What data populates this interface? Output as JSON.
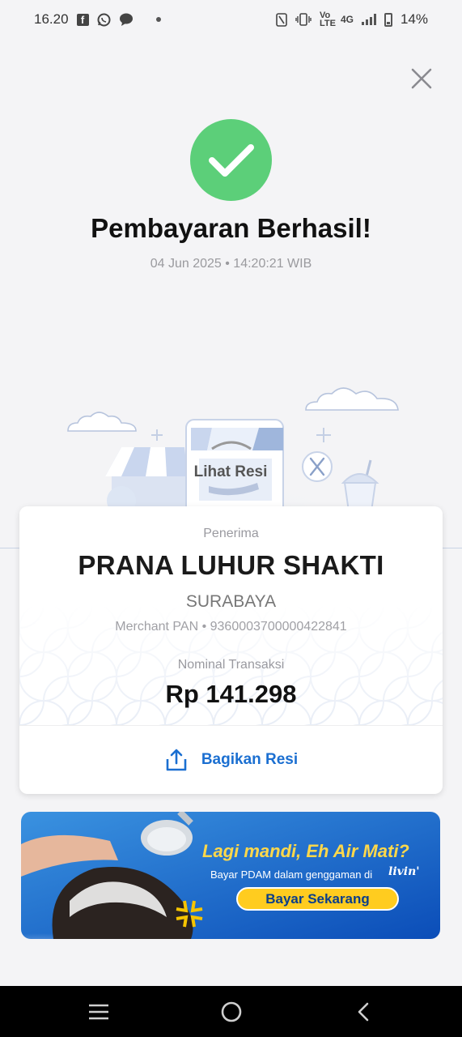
{
  "status_bar": {
    "time": "16.20",
    "network": "4G",
    "volte": "Vo LTE",
    "battery": "14%"
  },
  "success": {
    "title": "Pembayaran Berhasil!",
    "datetime": "04 Jun 2025 • 14:20:21 WIB",
    "accent_color": "#5ccf79"
  },
  "illustration": {
    "receipt_label": "Lihat Resi"
  },
  "card": {
    "recipient_label": "Penerima",
    "merchant_name": "PRANA LUHUR SHAKTI",
    "merchant_city": "SURABAYA",
    "merchant_pan": "Merchant PAN • 9360003700000422841",
    "amount_label": "Nominal Transaksi",
    "amount": "Rp 141.298",
    "share_label": "Bagikan Resi",
    "share_color": "#1b6fd1"
  },
  "banner": {
    "title": "Lagi mandi, Eh Air Mati?",
    "subtitle": "Bayar PDAM dalam genggaman di",
    "logo": "livin'",
    "cta": "Bayar Sekarang"
  },
  "icons": {
    "close": "close-icon",
    "success": "check-icon",
    "share": "share-icon",
    "nav_menu": "menu-icon",
    "nav_home": "home-icon",
    "nav_back": "back-icon"
  }
}
